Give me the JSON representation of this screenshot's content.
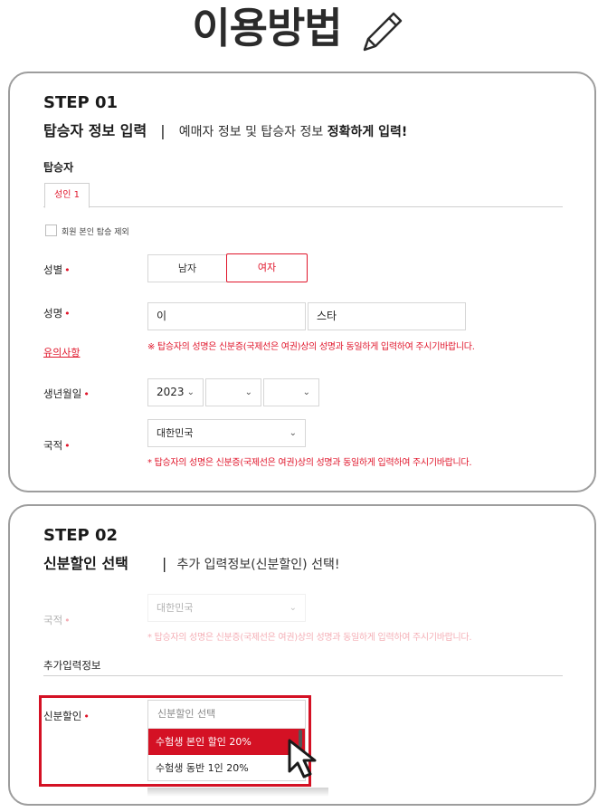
{
  "page_title": "이용방법",
  "step1": {
    "step_label": "STEP 01",
    "heading": "탑승자 정보 입력",
    "separator": "|",
    "subtitle_pre": "예매자 정보 및 탑승자 정보 ",
    "subtitle_bold": "정확하게 입력!",
    "section_label": "탑승자",
    "tab_label": "성인 1",
    "exclude_checkbox_label": "회원 본인 탑승 제외",
    "gender": {
      "label": "성별",
      "required_mark": "•",
      "options": [
        "남자",
        "여자"
      ],
      "selected": "여자"
    },
    "name": {
      "label": "성명",
      "required_mark": "•",
      "last_name_value": "이",
      "first_name_value": "스타",
      "note_link": "유의사항",
      "warning": "※ 탑승자의 성명은 신분증(국제선은 여권)상의 성명과 동일하게 입력하여 주시기바랍니다."
    },
    "birth": {
      "label": "생년월일",
      "required_mark": "•",
      "year_value": "2023",
      "month_value": "",
      "day_value": ""
    },
    "nationality": {
      "label": "국적",
      "required_mark": "•",
      "value": "대한민국",
      "warning": "* 탑승자의 성명은 신분증(국제선은 여권)상의 성명과 동일하게 입력하여 주시기바랍니다."
    }
  },
  "step2": {
    "step_label": "STEP 02",
    "heading": "신분할인 선택",
    "separator": "|",
    "subtitle": "추가 입력정보(신분할인) 선택!",
    "nationality": {
      "label": "국적",
      "required_mark": "•",
      "value": "대한민국",
      "warning": "* 탑승자의 성명은 신분증(국제선은 여권)상의 성명과 동일하게 입력하여 주시기바랍니다."
    },
    "extra_info_label": "추가입력정보",
    "discount": {
      "label": "신분할인",
      "required_mark": "•",
      "placeholder": "신분할인 선택",
      "options": [
        "수험생 본인 할인 20%",
        "수험생 동반 1인 20%"
      ],
      "highlighted": "수험생 본인 할인 20%"
    }
  },
  "icons": {
    "pencil": "pencil-icon",
    "chevron": "chevron-down-icon",
    "cursor": "hand-cursor-icon"
  },
  "colors": {
    "accent_red": "#e0162b",
    "highlight_red": "#d41124",
    "border_gray": "#9d9d9d"
  }
}
